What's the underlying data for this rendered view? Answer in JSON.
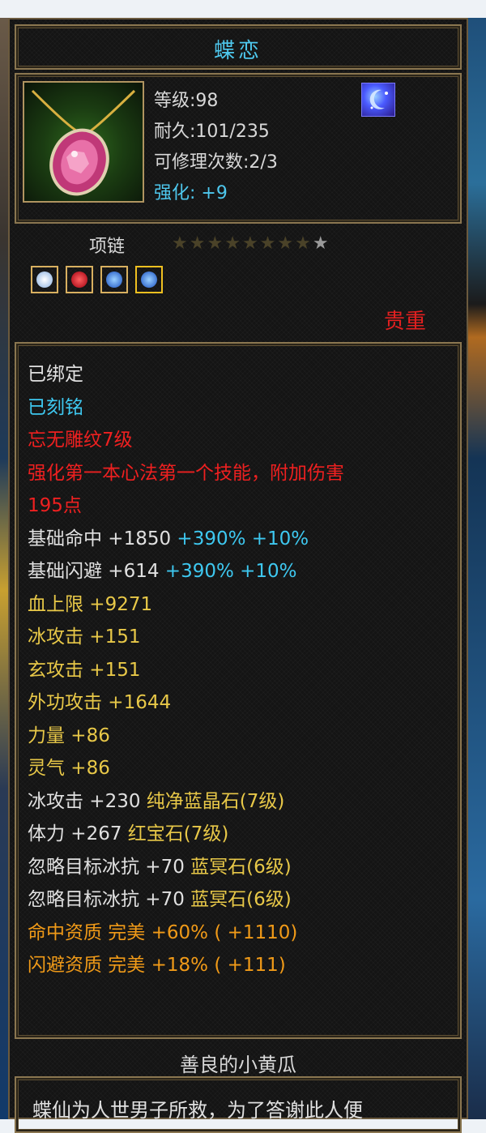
{
  "item": {
    "name": "蝶恋",
    "level": "等级:98",
    "durability": "耐久:101/235",
    "repair": "可修理次数:2/3",
    "enhance": "强化: +9",
    "icon": "pink-gem-necklace-icon",
    "badge_icon": "blue-moon-emblem-icon",
    "type": "项链",
    "stars_total": 9,
    "stars_lit": 1,
    "gem_icons": [
      "white-crystal-gem-icon",
      "red-ruby-gem-icon",
      "blue-sapphire-gem-icon",
      "blue-sapphire-gem-icon"
    ],
    "rarity": "贵重"
  },
  "colors": {
    "title": "#4ec8ee",
    "rarity": "#e22020",
    "white": "#e0e0e0",
    "cyan": "#3ec8f0",
    "red": "#ee2020",
    "yellow": "#e8c848",
    "orange": "#f09a18"
  },
  "attributes": [
    {
      "text": "已绑定",
      "color": "white"
    },
    {
      "text": "已刻铭",
      "color": "cyan"
    },
    {
      "text": "忘无雕纹7级",
      "color": "red"
    },
    {
      "text": "强化第一本心法第一个技能，附加伤害",
      "color": "red"
    },
    {
      "text": "195点",
      "color": "red"
    },
    {
      "text": "基础命中 +1850",
      "color": "white",
      "extra": " +390% +10%"
    },
    {
      "text": "基础闪避 +614",
      "color": "white",
      "extra": " +390% +10%"
    },
    {
      "text": "血上限 +9271",
      "color": "yellow"
    },
    {
      "text": "冰攻击 +151",
      "color": "yellow"
    },
    {
      "text": "玄攻击 +151",
      "color": "yellow"
    },
    {
      "text": "外功攻击 +1644",
      "color": "yellow"
    },
    {
      "text": "力量 +86",
      "color": "yellow"
    },
    {
      "text": "灵气 +86",
      "color": "yellow"
    },
    {
      "text": "冰攻击 +230 ",
      "color": "white",
      "gem": "纯净蓝晶石(7级)"
    },
    {
      "text": "体力 +267 ",
      "color": "white",
      "gem": "红宝石(7级)"
    },
    {
      "text": "忽略目标冰抗 +70 ",
      "color": "white",
      "gem": "蓝冥石(6级)"
    },
    {
      "text": "忽略目标冰抗 +70 ",
      "color": "white",
      "gem": "蓝冥石(6级)"
    },
    {
      "text": "命中资质   完美 +60% ( +1110)",
      "color": "orange"
    },
    {
      "text": "闪避资质   完美 +18% ( +111)",
      "color": "orange"
    }
  ],
  "owner": "善良的小黄瓜",
  "lore": "蝶仙为人世男子所救，为了答谢此人便"
}
